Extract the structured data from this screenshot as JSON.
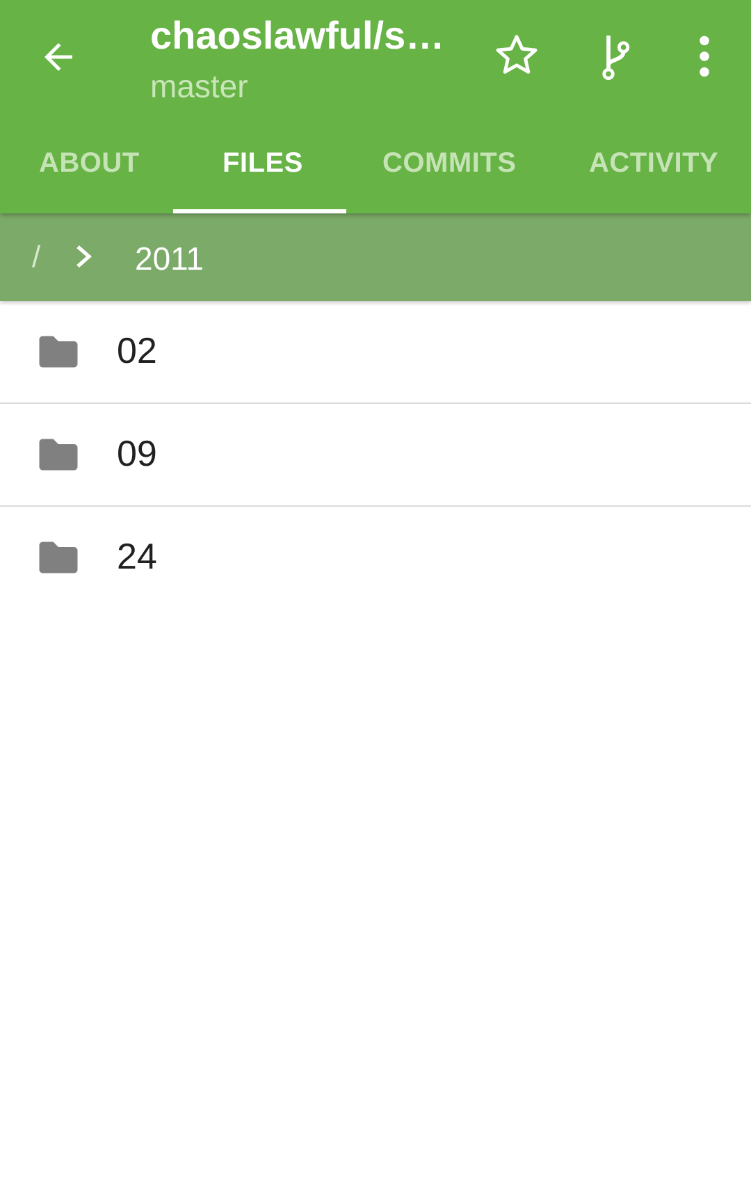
{
  "header": {
    "title": "chaoslawful/s…",
    "subtitle": "master",
    "back_icon": "arrow-left-icon",
    "star_icon": "star-outline-icon",
    "branch_icon": "git-branch-icon",
    "more_icon": "more-vert-icon"
  },
  "tabs": [
    {
      "label": "ABOUT"
    },
    {
      "label": "FILES"
    },
    {
      "label": "COMMITS"
    },
    {
      "label": "ACTIVITY"
    }
  ],
  "active_tab": "FILES",
  "breadcrumb": {
    "root": "/",
    "current": "2011"
  },
  "files": [
    {
      "name": "02",
      "icon": "folder-icon"
    },
    {
      "name": "09",
      "icon": "folder-icon"
    },
    {
      "name": "24",
      "icon": "folder-icon"
    }
  ],
  "colors": {
    "primary": "#67b346",
    "breadcrumb_bg": "#7caa68",
    "icon_gray": "#808080"
  }
}
